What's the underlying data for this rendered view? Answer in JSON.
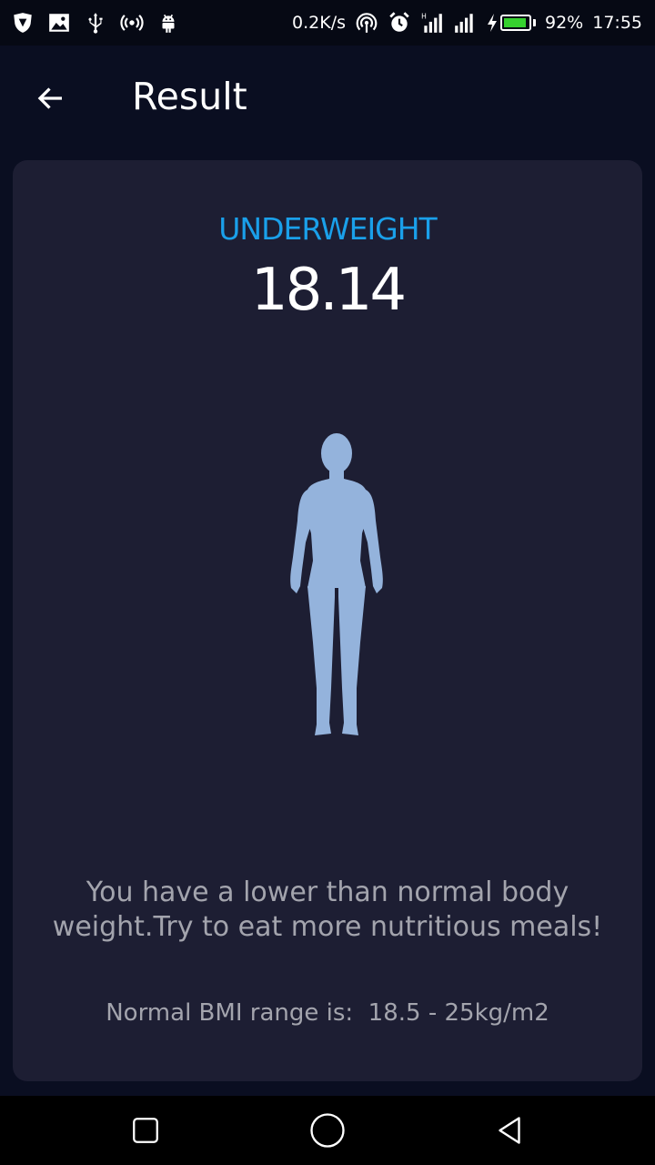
{
  "status_bar": {
    "net_speed": "0.2K/s",
    "battery_percent": "92%",
    "battery_level": 0.92,
    "battery_color": "#36d12f",
    "time": "17:55",
    "icons_left": [
      "shield-icon",
      "image-icon",
      "usb-icon",
      "broadcast-icon",
      "android-icon"
    ],
    "icons_right": [
      "hotspot-icon",
      "alarm-icon",
      "signal-icon",
      "signal-icon",
      "charging-icon",
      "battery-icon"
    ]
  },
  "app_bar": {
    "back_icon": "arrow-left-icon",
    "title": "Result"
  },
  "result": {
    "category": "UNDERWEIGHT",
    "category_color": "#1aa0ea",
    "bmi": "18.14",
    "figure_icon": "human-body-icon",
    "figure_color": "#94b3dc",
    "message": "You have a lower than normal body weight.Try to eat more nutritious meals!",
    "range_text": "Normal BMI range is:  18.5 - 25kg/m2"
  },
  "nav_bar": {
    "buttons": [
      "recents-square-icon",
      "home-circle-icon",
      "back-triangle-icon"
    ]
  }
}
